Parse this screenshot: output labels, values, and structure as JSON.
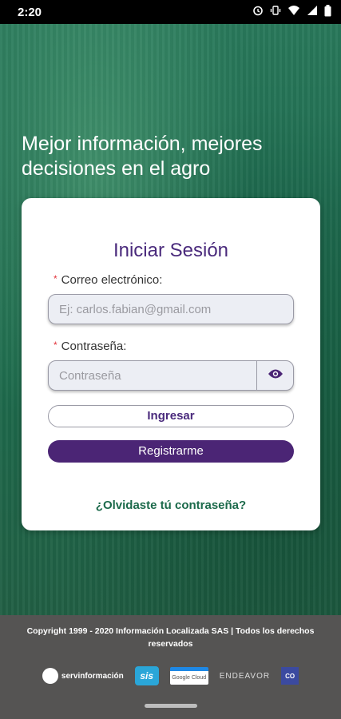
{
  "status_bar": {
    "time": "2:20",
    "icons": [
      "alarm-icon",
      "vibrate-icon",
      "wifi-icon",
      "signal-icon",
      "battery-icon"
    ]
  },
  "headline": "Mejor información, mejores decisiones en el agro",
  "login": {
    "title": "Iniciar Sesión",
    "email_label": "Correo electrónico:",
    "email_placeholder": "Ej: carlos.fabian@gmail.com",
    "password_label": "Contraseña:",
    "password_placeholder": "Contraseña",
    "submit_label": "Ingresar",
    "register_label": "Registrarme",
    "forgot_label": "¿Olvidaste tú contraseña?",
    "required_mark": "*"
  },
  "footer": {
    "copyright": "Copyright 1999 - 2020 Información Localizada SAS | Todos los derechos reservados",
    "logos": {
      "servinformacion": "servinformación",
      "sis": "sis",
      "google_cloud": "Google Cloud",
      "endeavor": "ENDEAVOR",
      "co": "CO"
    }
  },
  "colors": {
    "brand_purple": "#4b2575",
    "brand_green": "#1c6a4b",
    "required_red": "#e2323a",
    "footer_bg": "#555453"
  }
}
